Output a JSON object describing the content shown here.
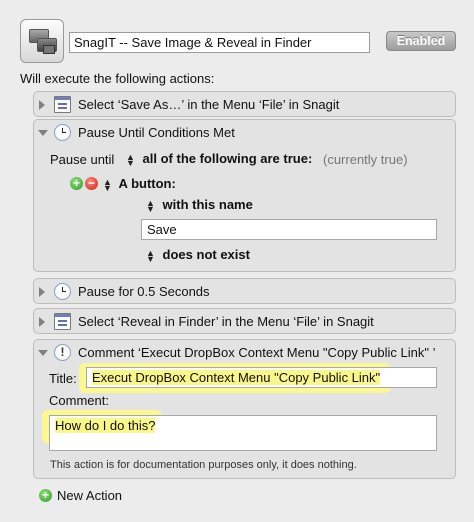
{
  "header": {
    "app_icon": "snagit-windows-icon",
    "macro_name": "SnagIT -- Save Image & Reveal in Finder",
    "enabled_label": "Enabled"
  },
  "intro_label": "Will execute the following actions:",
  "actions": [
    {
      "title": "Select ‘Save As…’ in the Menu ‘File’ in Snagit",
      "icon": "menu-icon",
      "expanded": false
    },
    {
      "title": "Pause Until Conditions Met",
      "icon": "clock-icon",
      "expanded": true,
      "pause_until_label": "Pause until",
      "condition_mode": "all of the following are true:",
      "status": "(currently true)",
      "condition_type": "A button:",
      "match_mode": "with this name",
      "button_name": "Save",
      "existence": "does not exist"
    },
    {
      "title": "Pause for 0.5 Seconds",
      "icon": "clock-icon",
      "expanded": false
    },
    {
      "title": "Select ‘Reveal in Finder’ in the Menu ‘File’ in Snagit",
      "icon": "menu-icon",
      "expanded": false
    },
    {
      "title": "Comment ‘Execut DropBox Context Menu \"Copy Public Link\" ’",
      "icon": "exclamation-icon",
      "expanded": true,
      "title_label": "Title:",
      "title_value": "Execut DropBox Context Menu \"Copy Public Link\"",
      "comment_label": "Comment:",
      "comment_value": "How do I do this?",
      "note": "This action is for documentation purposes only, it does nothing."
    }
  ],
  "footer": {
    "new_action_label": "New Action"
  },
  "colors": {
    "highlight": "#f9f68a",
    "add": "#2f9a22",
    "remove": "#c42316"
  }
}
